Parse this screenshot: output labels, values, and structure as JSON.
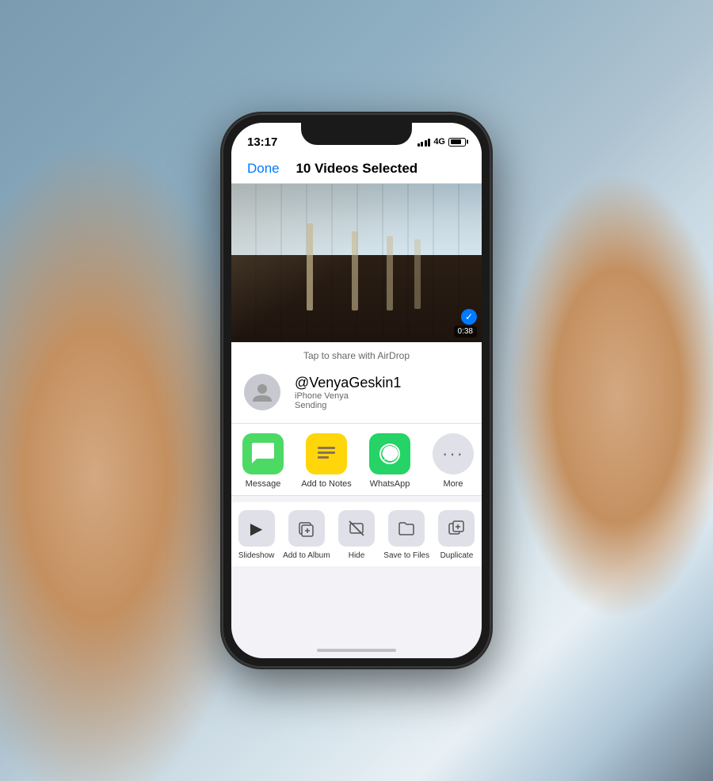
{
  "background": {
    "color": "#7a9bb0"
  },
  "phone": {
    "statusBar": {
      "time": "13:17",
      "signal": "4G"
    },
    "navBar": {
      "doneLabel": "Done",
      "title": "10 Videos Selected"
    },
    "photo": {
      "duration": "0:38"
    },
    "shareSheet": {
      "airdropHint": "Tap to share with AirDrop",
      "username": "@VenyaGeskin1",
      "deviceName": "iPhone Venya",
      "deviceStatus": "Sending",
      "apps": [
        {
          "id": "message",
          "label": "Message"
        },
        {
          "id": "notes",
          "label": "Add to Notes"
        },
        {
          "id": "whatsapp",
          "label": "WhatsApp"
        },
        {
          "id": "more",
          "label": "More"
        }
      ],
      "actions": [
        {
          "id": "slideshow",
          "label": "Slideshow"
        },
        {
          "id": "add-album",
          "label": "Add to Album"
        },
        {
          "id": "hide",
          "label": "Hide"
        },
        {
          "id": "save-files",
          "label": "Save to Files"
        },
        {
          "id": "duplicate",
          "label": "Duplicate"
        }
      ]
    }
  }
}
